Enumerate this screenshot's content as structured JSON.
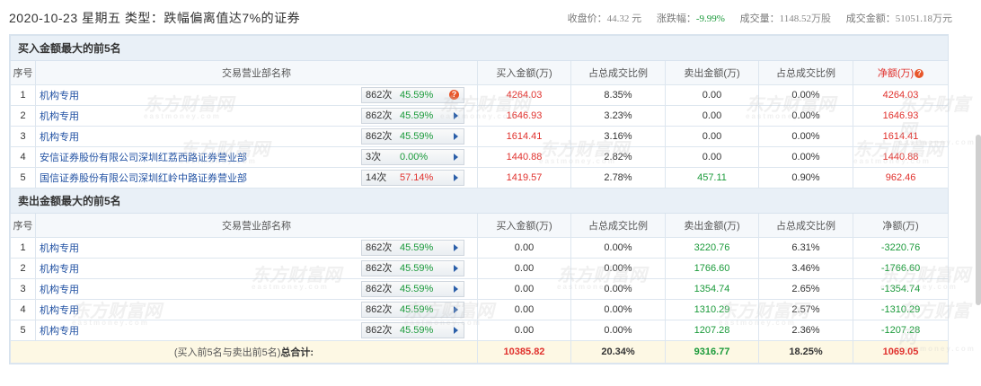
{
  "header": {
    "title": "2020-10-23 星期五 类型：跌幅偏离值达7%的证券",
    "close_label": "收盘价：",
    "close_value": "44.32 元",
    "change_label": "涨跌幅：",
    "change_value": "-9.99%",
    "volume_label": "成交量：",
    "volume_value": "1148.52万股",
    "amount_label": "成交金额：",
    "amount_value": "51051.18万元"
  },
  "columns": {
    "seq": "序号",
    "name": "交易营业部名称",
    "buy": "买入金额(万)",
    "buy_ratio": "占总成交比例",
    "sell": "卖出金额(万)",
    "sell_ratio": "占总成交比例",
    "net": "净额(万)"
  },
  "buy_section": {
    "title": "买入金额最大的前5名",
    "rows": [
      {
        "seq": "1",
        "name": "机构专用",
        "count": "862次",
        "pct": "45.59%",
        "buy": "4264.03",
        "buy_ratio": "8.35%",
        "sell": "0.00",
        "sell_ratio": "0.00%",
        "net": "4264.03"
      },
      {
        "seq": "2",
        "name": "机构专用",
        "count": "862次",
        "pct": "45.59%",
        "buy": "1646.93",
        "buy_ratio": "3.23%",
        "sell": "0.00",
        "sell_ratio": "0.00%",
        "net": "1646.93"
      },
      {
        "seq": "3",
        "name": "机构专用",
        "count": "862次",
        "pct": "45.59%",
        "buy": "1614.41",
        "buy_ratio": "3.16%",
        "sell": "0.00",
        "sell_ratio": "0.00%",
        "net": "1614.41"
      },
      {
        "seq": "4",
        "name": "安信证券股份有限公司深圳红荔西路证券营业部",
        "count": "3次",
        "pct": "0.00%",
        "buy": "1440.88",
        "buy_ratio": "2.82%",
        "sell": "0.00",
        "sell_ratio": "0.00%",
        "net": "1440.88"
      },
      {
        "seq": "5",
        "name": "国信证券股份有限公司深圳红岭中路证券营业部",
        "count": "14次",
        "pct": "57.14%",
        "buy": "1419.57",
        "buy_ratio": "2.78%",
        "sell": "457.11",
        "sell_ratio": "0.90%",
        "net": "962.46"
      }
    ]
  },
  "sell_section": {
    "title": "卖出金额最大的前5名",
    "rows": [
      {
        "seq": "1",
        "name": "机构专用",
        "count": "862次",
        "pct": "45.59%",
        "buy": "0.00",
        "buy_ratio": "0.00%",
        "sell": "3220.76",
        "sell_ratio": "6.31%",
        "net": "-3220.76"
      },
      {
        "seq": "2",
        "name": "机构专用",
        "count": "862次",
        "pct": "45.59%",
        "buy": "0.00",
        "buy_ratio": "0.00%",
        "sell": "1766.60",
        "sell_ratio": "3.46%",
        "net": "-1766.60"
      },
      {
        "seq": "3",
        "name": "机构专用",
        "count": "862次",
        "pct": "45.59%",
        "buy": "0.00",
        "buy_ratio": "0.00%",
        "sell": "1354.74",
        "sell_ratio": "2.65%",
        "net": "-1354.74"
      },
      {
        "seq": "4",
        "name": "机构专用",
        "count": "862次",
        "pct": "45.59%",
        "buy": "0.00",
        "buy_ratio": "0.00%",
        "sell": "1310.29",
        "sell_ratio": "2.57%",
        "net": "-1310.29"
      },
      {
        "seq": "5",
        "name": "机构专用",
        "count": "862次",
        "pct": "45.59%",
        "buy": "0.00",
        "buy_ratio": "0.00%",
        "sell": "1207.28",
        "sell_ratio": "2.36%",
        "net": "-1207.28"
      }
    ]
  },
  "total": {
    "label": "(买入前5名与卖出前5名)",
    "label_bold": "总合计:",
    "buy": "10385.82",
    "buy_ratio": "20.34%",
    "sell": "9316.77",
    "sell_ratio": "18.25%",
    "net": "1069.05"
  },
  "watermark": {
    "cn": "东方财富网",
    "en": "eastmoney.com"
  },
  "colors": {
    "up": "#e0312d",
    "down": "#1a9a3a",
    "link": "#2252a3",
    "section_bg": "#e9f0f7",
    "total_bg": "#fdf8e4"
  }
}
